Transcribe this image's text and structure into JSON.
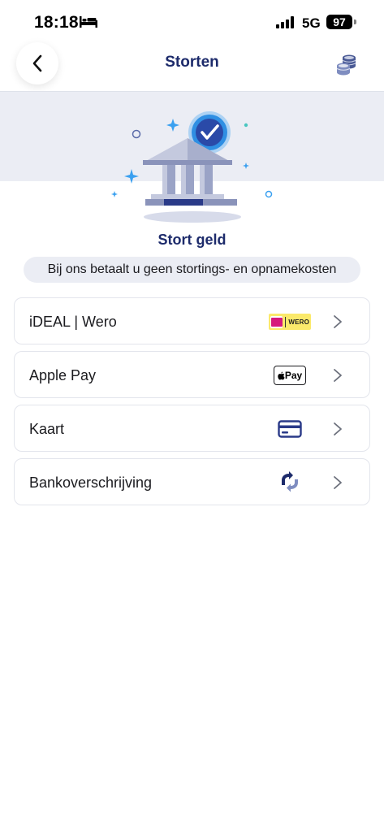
{
  "status_bar": {
    "time": "18:18",
    "network": "5G",
    "battery": "97"
  },
  "nav": {
    "title": "Storten",
    "back_icon": "chevron-left-icon",
    "right_icon": "coins-icon"
  },
  "hero": {
    "title": "Stort geld",
    "subtitle": "Bij ons betaalt u geen stortings- en opnamekosten"
  },
  "methods": [
    {
      "label": "iDEAL | Wero",
      "icon": "ideal-wero-logo",
      "logo_text": "WERO"
    },
    {
      "label": "Apple Pay",
      "icon": "apple-pay-logo",
      "logo_text": "Pay"
    },
    {
      "label": "Kaart",
      "icon": "credit-card-icon"
    },
    {
      "label": "Bankoverschrijving",
      "icon": "bank-transfer-icon"
    }
  ],
  "colors": {
    "brand_navy": "#1d2b6b",
    "hero_band": "#ebedf4",
    "accent_blue": "#3aa0f0"
  }
}
